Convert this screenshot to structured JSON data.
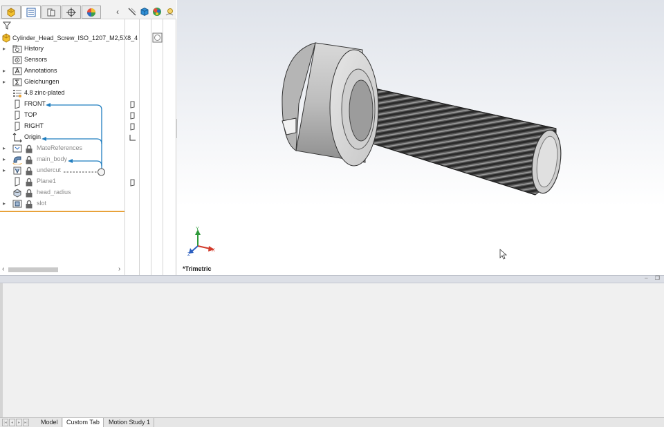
{
  "feature_tree": {
    "root_label": "Cylinder_Head_Screw_ISO_1207_M2,5X8_4",
    "items": [
      {
        "label": "History",
        "expandable": true,
        "locked": false
      },
      {
        "label": "Sensors",
        "expandable": false,
        "locked": false
      },
      {
        "label": "Annotations",
        "expandable": true,
        "locked": false
      },
      {
        "label": "Gleichungen",
        "expandable": true,
        "locked": false
      },
      {
        "label": "4.8 zinc-plated",
        "expandable": false,
        "locked": false
      },
      {
        "label": "FRONT",
        "expandable": false,
        "locked": false
      },
      {
        "label": "TOP",
        "expandable": false,
        "locked": false
      },
      {
        "label": "RIGHT",
        "expandable": false,
        "locked": false
      },
      {
        "label": "Origin",
        "expandable": false,
        "locked": false
      },
      {
        "label": "MateReferences",
        "expandable": true,
        "locked": true
      },
      {
        "label": "main_body",
        "expandable": true,
        "locked": true
      },
      {
        "label": "undercut",
        "expandable": true,
        "locked": true
      },
      {
        "label": "Plane1",
        "expandable": false,
        "locked": true
      },
      {
        "label": "head_radius",
        "expandable": false,
        "locked": true
      },
      {
        "label": "slot",
        "expandable": true,
        "locked": true
      }
    ]
  },
  "viewport": {
    "view_orientation": "*Trimetric",
    "triad_axes": {
      "x": "X",
      "y": "Y",
      "z": "Z"
    }
  },
  "bottom_tabs": {
    "tabs": [
      "Model",
      "Custom Tab",
      "Motion Study 1"
    ],
    "active": "Custom Tab"
  },
  "colors": {
    "accent_blue": "#1f7dbf",
    "rollback_orange": "#e8a23a",
    "locked_text": "#8a8a8a"
  }
}
